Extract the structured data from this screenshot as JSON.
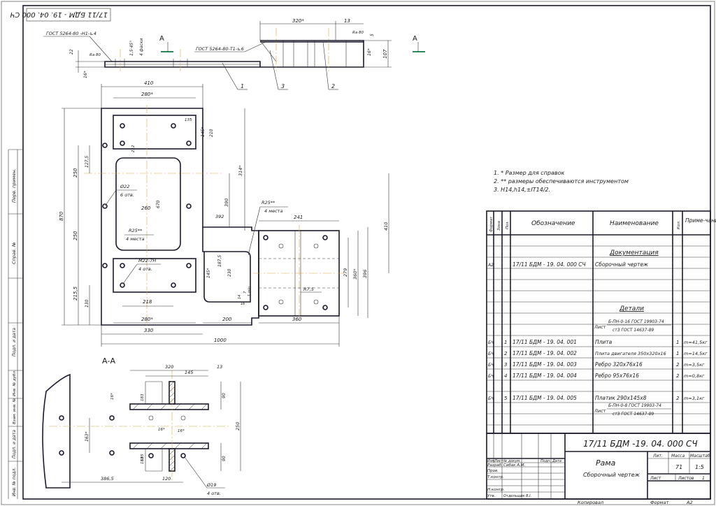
{
  "rotated_code": "17/11 БДМ - 19. 04. 000 СЧ",
  "section_label": "А-А",
  "view_marker": "А",
  "weld_notes": {
    "weld_left": "ГОСТ 5264-80 -Н1-⊾4",
    "weld_right": "ГОСТ 5264-80-Т1-⊾6"
  },
  "leaders": [
    "1",
    "2",
    "3"
  ],
  "dims": {
    "top_view": {
      "d320": "320*",
      "d13": "13",
      "d5": "5",
      "d107": "107",
      "d16": "16*",
      "d22": "22",
      "d16b": "16*",
      "d1545": "1,5·45°",
      "d4f": "4 фаски",
      "ra": "Ra 80",
      "ra2": "Ra 80"
    },
    "plan": {
      "d410": "410",
      "d280a": "280*",
      "d135": "135",
      "d145": "145*",
      "d210": "210",
      "d212": "212",
      "d1275": "127,5",
      "d250a": "250",
      "d870": "870",
      "d250b": "250",
      "d2155": "215,5",
      "d130": "130",
      "d22": "Ø22",
      "d6otv": "6 отв.",
      "d260": "260",
      "d670": "670",
      "d314": "314*",
      "d390": "390",
      "d392": "392",
      "dR25a": "R25**",
      "d4m1": "4 места",
      "dR25b": "R25**",
      "d4m2": "4 места",
      "dM22": "М22-7Н",
      "d4otv": "4 отв.",
      "d218": "218",
      "d280b": "280*",
      "d330": "330",
      "d241": "241",
      "d410r": "410",
      "d279": "279",
      "d360r": "360*",
      "d396": "396",
      "d1875": "187,5",
      "d230": "230",
      "d145b": "145*",
      "dR75": "R7,5",
      "d200": "200",
      "d360b": "360",
      "d1000": "1000",
      "d14": "14",
      "d7": "7",
      "d1m": "1 min",
      "d16": "16"
    },
    "section": {
      "d320": "320",
      "d145": "145",
      "d13": "13",
      "d183": "183",
      "d16": "16*",
      "d90a": "90",
      "d250": "250",
      "d16b": "16*",
      "d16c": "16*",
      "d183b": "183",
      "d90b": "90",
      "d1635": "163*",
      "d3865": "386,5",
      "d120": "120",
      "d185": "185",
      "d19": "Ø19",
      "d4otv": "4 отв."
    }
  },
  "notes": [
    "1. * Размер для справок",
    "2. ** размеры обеспечиваются инструментом",
    "3. Н14,h14,±IT14/2."
  ],
  "spec": {
    "headers": {
      "format": "Формат",
      "zone": "Зона",
      "pos": "Поз.",
      "designation": "Обозначение",
      "name": "Наименование",
      "qty": "Кол.",
      "note": "Приме-чание"
    },
    "section_docs": "Документация",
    "doc_row": {
      "format": "А2",
      "designation": "17/11 БДМ - 19. 04. 000 СЧ",
      "name": "Сборочный чертеж"
    },
    "section_parts": "Детали",
    "material1": {
      "prefix": "Лист",
      "top": "Б-ПН-0-16 ГОСТ 19903-74",
      "bottom": "ст3 ГОСТ 14637-89"
    },
    "rows": [
      {
        "format": "БЧ",
        "pos": "1",
        "designation": "17/11 БДМ - 19. 04. 001",
        "name": "Плита",
        "qty": "1",
        "note": "m=41,5кг"
      },
      {
        "format": "БЧ",
        "pos": "2",
        "designation": "17/11 БДМ - 19. 04. 002",
        "name": "Плита двигателя 350х320х16",
        "qty": "1",
        "note": "m=14,5кг"
      },
      {
        "format": "БЧ",
        "pos": "3",
        "designation": "17/11 БДМ - 19. 04. 003",
        "name": "Ребро 320х76х16",
        "qty": "2",
        "note": "m=3,5кг"
      },
      {
        "format": "БЧ",
        "pos": "4",
        "designation": "17/11 БДМ - 19. 04. 004",
        "name": "Ребро 95х76х16",
        "qty": "2",
        "note": "m=0,8кг"
      },
      {
        "format": "БЧ",
        "pos": "5",
        "designation": "17/11 БДМ - 19. 04. 005",
        "name": "Платик 290х145х8",
        "qty": "2",
        "note": "m=3,1кг"
      }
    ],
    "material2": {
      "prefix": "Лист",
      "top": "Б-ПН-0-8 ГОСТ 19903-74",
      "bottom": "ст3 ГОСТ 14637-89"
    }
  },
  "title_block": {
    "code": "17/11 БДМ -19. 04. 000 СЧ",
    "name": "Рама",
    "subtitle": "Сборочный чертеж",
    "lit": "Лит.",
    "mass": "Масса",
    "scale": "Масштаб",
    "mass_val": "71",
    "scale_val": "1:5",
    "sheet": "Лист",
    "sheets": "Листов",
    "sheets_val": "1",
    "izm": "Изм.",
    "list": "Лист",
    "ndoc": "№ докум.",
    "podp": "Подп.",
    "data": "Дата",
    "razrab": "Разраб.",
    "razrab_name": "Сибак А.М.",
    "prov": "Пров.",
    "tkontr": "Т.контр.",
    "nkontr": "Н.контр.",
    "utv": "Утв.",
    "utv_name": "Отдельщик В.І."
  },
  "footer": {
    "copied": "Копировал",
    "format": "Формат",
    "format_val": "А2"
  },
  "side_stamp": {
    "perv": "Перв. примен.",
    "sprav": "Справ. №",
    "podp_data1": "Подп. и дата",
    "inv_dubl": "Инв. № дубл.",
    "vzam": "Взам. инв. №",
    "podp_data2": "Подп. и дата",
    "inv_podl": "Инв. № подл."
  }
}
